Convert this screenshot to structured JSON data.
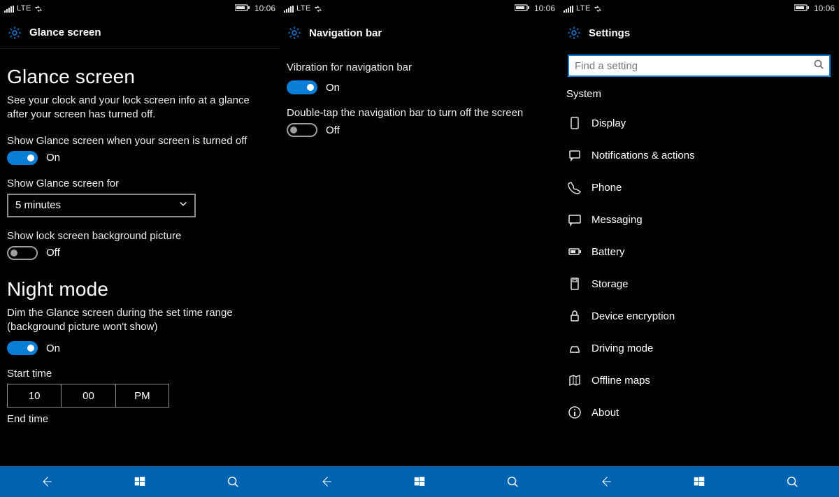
{
  "status": {
    "network": "LTE",
    "time": "10:06"
  },
  "pane1": {
    "header": "Glance screen",
    "title": "Glance screen",
    "desc": "See your clock and your lock screen info at a glance after your screen has turned off.",
    "show_glance_label": "Show Glance screen when your screen is turned off",
    "show_glance_state": "On",
    "duration_label": "Show Glance screen for",
    "duration_value": "5 minutes",
    "lock_bg_label": "Show lock screen background picture",
    "lock_bg_state": "Off",
    "night_title": "Night mode",
    "night_desc": "Dim the Glance screen during the set time range (background picture won't show)",
    "night_state": "On",
    "start_label": "Start time",
    "start_h": "10",
    "start_m": "00",
    "start_p": "PM",
    "end_label": "End time"
  },
  "pane2": {
    "header": "Navigation bar",
    "vibration_label": "Vibration for navigation bar",
    "vibration_state": "On",
    "dtap_label": "Double-tap the navigation bar to turn off the screen",
    "dtap_state": "Off"
  },
  "pane3": {
    "header": "Settings",
    "search_placeholder": "Find a setting",
    "category": "System",
    "items": [
      {
        "label": "Display"
      },
      {
        "label": "Notifications & actions"
      },
      {
        "label": "Phone"
      },
      {
        "label": "Messaging"
      },
      {
        "label": "Battery"
      },
      {
        "label": "Storage"
      },
      {
        "label": "Device encryption"
      },
      {
        "label": "Driving mode"
      },
      {
        "label": "Offline maps"
      },
      {
        "label": "About"
      }
    ]
  }
}
